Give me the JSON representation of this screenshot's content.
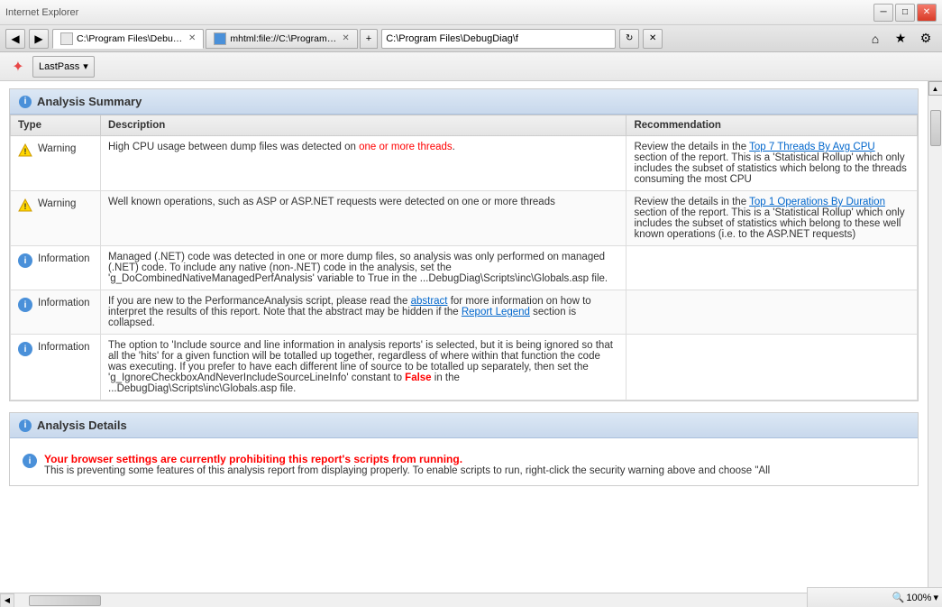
{
  "titlebar": {
    "minimize_label": "─",
    "restore_label": "□",
    "close_label": "✕"
  },
  "addressbar": {
    "nav_back": "◀",
    "nav_forward": "▶",
    "tab1_url": "C:\\Program Files\\DebugDiag\\f",
    "tab1_label": "C:\\Program Files\\DebugDiag\\f",
    "tab2_url": "mhtml:file://C:\\Program Fil...",
    "tab2_label": "mhtml:file://C:\\Program Fil...",
    "home_icon": "⌂",
    "fav_icon": "★",
    "settings_icon": "⚙"
  },
  "toolbar": {
    "lastpass_label": "LastPass",
    "lastpass_dropdown": "▾"
  },
  "analysis_summary": {
    "section_title": "Analysis Summary",
    "columns": {
      "type": "Type",
      "description": "Description",
      "recommendation": "Recommendation"
    },
    "rows": [
      {
        "type": "Warning",
        "icon": "warning",
        "description": "High CPU usage between dump files was detected on one or more threads.",
        "recommendation_prefix": "Review the details in the ",
        "recommendation_link": "Top 7 Threads By Avg CPU",
        "recommendation_suffix": " section of the report. This is a 'Statistical Rollup' which only includes the subset of statistics which belong to the threads consuming the most CPU"
      },
      {
        "type": "Warning",
        "icon": "warning",
        "description": "Well known operations, such as ASP or ASP.NET requests were detected on one or more threads",
        "recommendation_prefix": "Review the details in the ",
        "recommendation_link": "Top 1 Operations By Duration",
        "recommendation_suffix": " section of the report. This is a 'Statistical Rollup' which only includes the subset of statistics which belong to these well known operations (i.e. to the ASP.NET requests)"
      },
      {
        "type": "Information",
        "icon": "info",
        "description": "Managed (.NET) code was detected in one or more dump files, so analysis was only performed on managed (.NET) code. To include any native (non-.NET) code in the analysis, set the 'g_DoCombinedNativeManagedPerfAnalysis' variable to True in the ...DebugDiag\\Scripts\\inc\\Globals.asp file.",
        "recommendation": ""
      },
      {
        "type": "Information",
        "icon": "info",
        "description_prefix": "If you are new to the PerformanceAnalysis script, please read the ",
        "description_link1": "abstract",
        "description_mid": " for more information on how to interpret the results of this report.   Note that the abstract may be hidden if the ",
        "description_link2": "Report Legend",
        "description_suffix": " section is collapsed.",
        "recommendation": ""
      },
      {
        "type": "Information",
        "icon": "info",
        "description_prefix": "The option to 'Include source and line information in analysis reports' is selected, but it is being ignored so that all the 'hits' for a given function will be totalled up together, regardless of where within that function the code was executing. If you prefer to have each different line of source to be totalled up separately, then set the 'g_IgnoreCheckboxAndNeverIncludeSourceLineInfo' constant to ",
        "description_red": "False",
        "description_suffix2": " in the ...DebugDiag\\Scripts\\inc\\Globals.asp file.",
        "recommendation": ""
      }
    ]
  },
  "analysis_details": {
    "section_title": "Analysis Details",
    "notice_red": "Your browser settings are currently prohibiting this report's scripts from running.",
    "notice_normal": "This is preventing some features of this analysis report from displaying properly. To enable scripts to run, right-click the security warning above and choose \"All"
  },
  "statusbar": {
    "zoom_label": "100%",
    "zoom_icon": "🔍"
  }
}
